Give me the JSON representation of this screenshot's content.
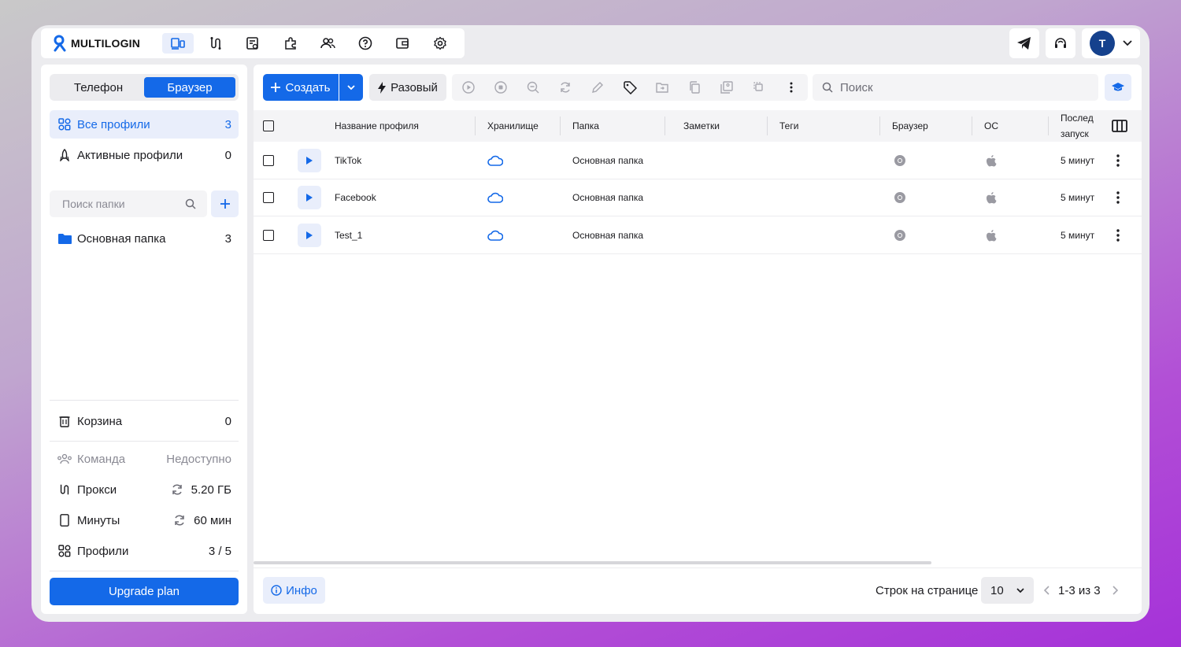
{
  "app": {
    "logo_text": "MULTILOGIN"
  },
  "topnav": {
    "icons": [
      "profiles-icon",
      "proxy-icon",
      "scripts-icon",
      "extensions-icon",
      "team-icon",
      "help-icon",
      "wallet-icon",
      "settings-icon"
    ],
    "avatar_letter": "T"
  },
  "sidebar": {
    "segment": {
      "phone": "Телефон",
      "browser": "Браузер"
    },
    "all_profiles": {
      "label": "Все профили",
      "count": "3"
    },
    "active_profiles": {
      "label": "Активные профили",
      "count": "0"
    },
    "folder_search": {
      "placeholder": "Поиск папки"
    },
    "folders": [
      {
        "label": "Основная папка",
        "count": "3"
      }
    ],
    "trash": {
      "label": "Корзина",
      "count": "0"
    },
    "team": {
      "label": "Команда",
      "value": "Недоступно"
    },
    "proxy": {
      "label": "Прокси",
      "value": "5.20 ГБ"
    },
    "minutes": {
      "label": "Минуты",
      "value": "60 мин"
    },
    "profiles": {
      "label": "Профили",
      "value": "3 / 5"
    },
    "upgrade": "Upgrade plan"
  },
  "toolbar": {
    "create": "Создать",
    "one_off": "Разовый",
    "search_placeholder": "Поиск"
  },
  "table": {
    "columns": {
      "name": "Название профиля",
      "storage": "Хранилище",
      "folder": "Папка",
      "notes": "Заметки",
      "tags": "Теги",
      "browser": "Браузер",
      "os": "ОС",
      "last_launch_1": "Послед",
      "last_launch_2": "запуск"
    },
    "rows": [
      {
        "name": "TikTok",
        "folder": "Основная папка",
        "last": "5 минут"
      },
      {
        "name": "Facebook",
        "folder": "Основная папка",
        "last": "5 минут"
      },
      {
        "name": "Test_1",
        "folder": "Основная папка",
        "last": "5 минут"
      }
    ]
  },
  "footer": {
    "info": "Инфо",
    "rows_per_page_label": "Строк на странице",
    "rows_per_page": "10",
    "range": "1-3 из 3"
  },
  "colors": {
    "accent": "#1469e8",
    "accent_light": "#e9eefb"
  }
}
